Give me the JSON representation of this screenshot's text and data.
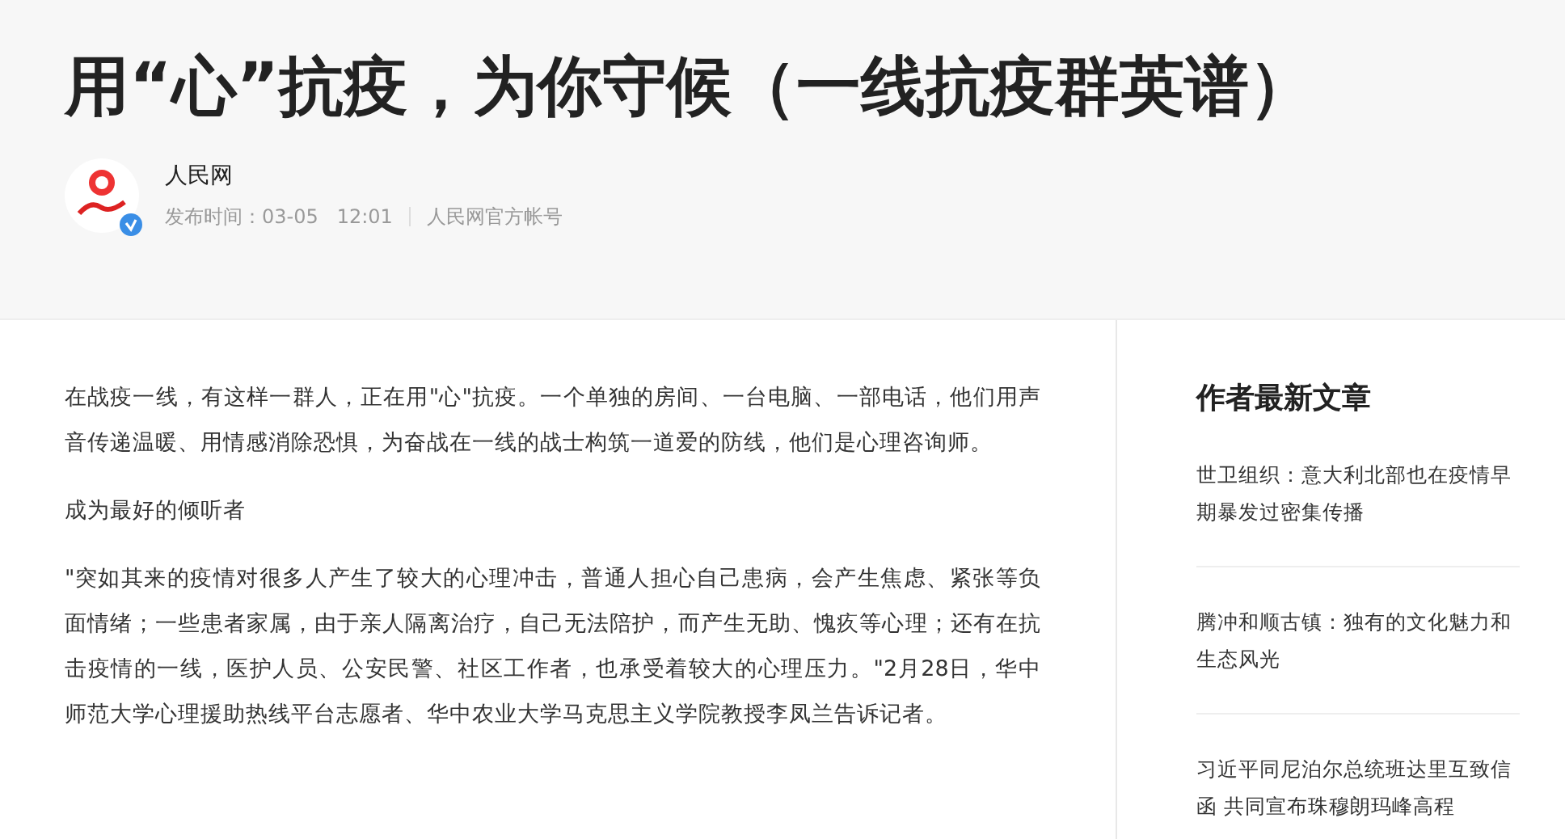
{
  "article": {
    "title": "用“心”抗疫，为你守候（一线抗疫群英谱）",
    "author": {
      "name": "人民网",
      "verified": true,
      "published": "发布时间：03-05   12:01",
      "account": "人民网官方帐号"
    },
    "paragraphs": [
      "在战疫一线，有这样一群人，正在用\"心\"抗疫。一个单独的房间、一台电脑、一部电话，他们用声音传递温暖、用情感消除恐惧，为奋战在一线的战士构筑一道爱的防线，他们是心理咨询师。",
      "成为最好的倾听者",
      "\"突如其来的疫情对很多人产生了较大的心理冲击，普通人担心自己患病，会产生焦虑、紧张等负面情绪；一些患者家属，由于亲人隔离治疗，自己无法陪护，而产生无助、愧疚等心理；还有在抗击疫情的一线，医护人员、公安民警、社区工作者，也承受着较大的心理压力。\"2月28日，华中师范大学心理援助热线平台志愿者、华中农业大学马克思主义学院教授李凤兰告诉记者。"
    ]
  },
  "sidebar": {
    "heading": "作者最新文章",
    "articles": [
      "世卫组织：意大利北部也在疫情早期暴发过密集传播",
      "腾冲和顺古镇：独有的文化魅力和生态风光",
      "习近平同尼泊尔总统班达里互致信函 共同宣布珠穆朗玛峰高程"
    ]
  }
}
